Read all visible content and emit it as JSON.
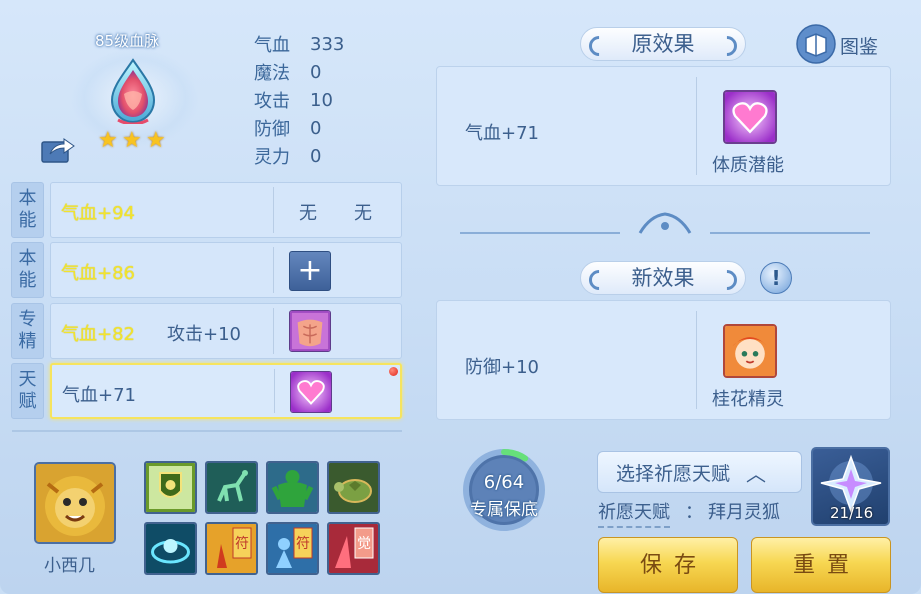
{
  "blood_vein": {
    "title": "85级血脉",
    "stars": 3,
    "stats": [
      {
        "label": "气血",
        "value": "333"
      },
      {
        "label": "魔法",
        "value": "0"
      },
      {
        "label": "攻击",
        "value": "10"
      },
      {
        "label": "防御",
        "value": "0"
      },
      {
        "label": "灵力",
        "value": "0"
      }
    ]
  },
  "rows": [
    {
      "tag": [
        "本",
        "能"
      ],
      "main": "气血+94",
      "extra": "",
      "slot": "none",
      "none_a": "无",
      "none_b": "无"
    },
    {
      "tag": [
        "本",
        "能"
      ],
      "main": "气血+86",
      "extra": "",
      "slot": "plus",
      "plus_label": "+"
    },
    {
      "tag": [
        "专",
        "精"
      ],
      "main": "气血+82",
      "extra": "攻击+10",
      "slot": "icon",
      "icon": "muscle-body-icon"
    },
    {
      "tag": [
        "天",
        "赋"
      ],
      "main": "气血+71",
      "extra": "",
      "slot": "icon",
      "icon": "heart-icon"
    }
  ],
  "pet": {
    "name": "小西几"
  },
  "skills": [
    "shield-emblem-icon",
    "green-deer-icon",
    "green-giant-icon",
    "turtle-icon",
    "cyan-aura-icon",
    "fire-talisman-icon",
    "blue-talisman-icon",
    "red-awaken-icon"
  ],
  "progress": {
    "count": "6/64",
    "label": "专属保底",
    "fraction": 0.094
  },
  "wish": {
    "select_label": "选择祈愿天赋",
    "talent_label": "祈愿天赋",
    "colon": "：",
    "talent_value": "拜月灵狐",
    "crystal_count": "21/16"
  },
  "buttons": {
    "save": "保存",
    "reset": "重置"
  },
  "original_effect": {
    "title": "原效果",
    "text": "气血+71",
    "icon_name": "体质潜能"
  },
  "new_effect": {
    "title": "新效果",
    "text": "防御+10",
    "icon_name": "桂花精灵"
  },
  "tujian": {
    "label": "图鉴"
  },
  "info": {
    "label": "!"
  },
  "colors": {
    "accent_yellow": "#f2e42d",
    "text_blue": "#3c5f8d",
    "button_gold": "#f7d752"
  }
}
